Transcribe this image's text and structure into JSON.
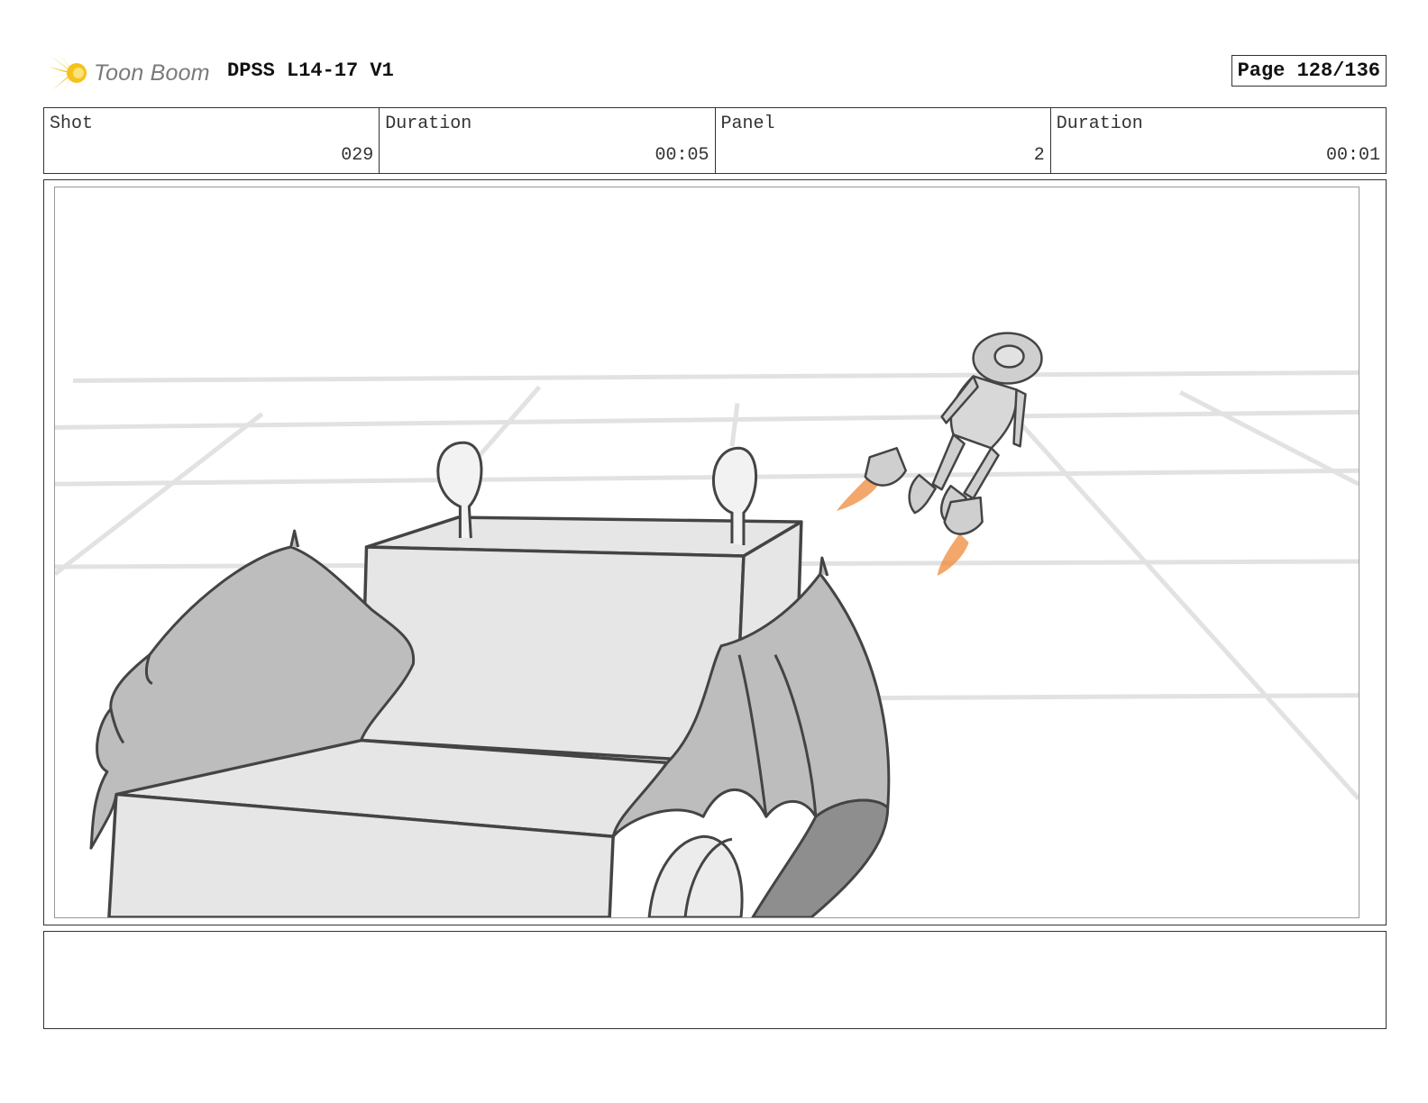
{
  "header": {
    "logo_icon": "toon-boom-burst-icon",
    "logo_text": "Toon Boom",
    "project_title": "DPSS L14-17 V1",
    "page_label": "Page 128/136"
  },
  "info": {
    "shot_label": "Shot",
    "shot_value": "029",
    "shot_duration_label": "Duration",
    "shot_duration_value": "00:05",
    "panel_label": "Panel",
    "panel_value": "2",
    "panel_duration_label": "Duration",
    "panel_duration_value": "00:01"
  },
  "colors": {
    "logo_yellow": "#f5c21b",
    "logo_gray": "#7a7a7a",
    "flame": "#f08a3a",
    "sketch_fill": "#e3e3e3",
    "wing_fill": "#bdbdbd"
  },
  "notes": {
    "text": ""
  }
}
